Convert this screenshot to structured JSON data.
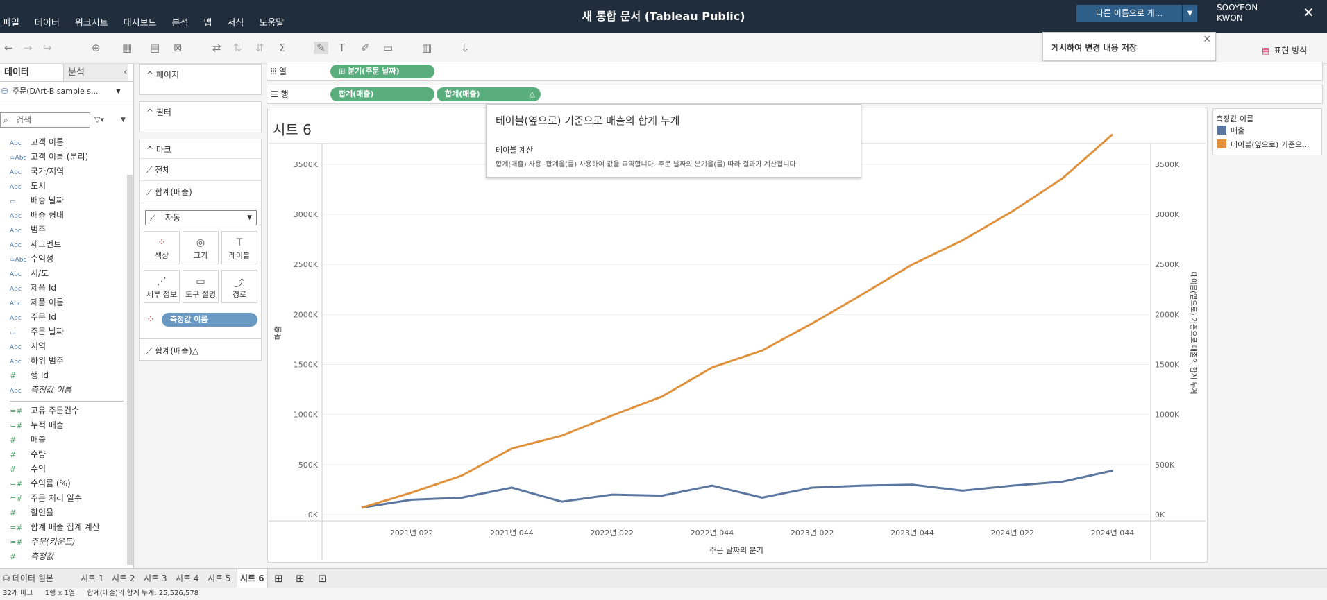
{
  "app": {
    "title": "새 통합 문서 (Tableau Public)",
    "menu": [
      "파일",
      "데이터",
      "워크시트",
      "대시보드",
      "분석",
      "맵",
      "서식",
      "도움말"
    ],
    "save_button": "다른 이름으로 게...",
    "user_name": [
      "SOOYEON",
      "KWON"
    ],
    "save_tooltip": "게시하여 변경 내용 저장",
    "present_label": "표현 방식"
  },
  "data_pane": {
    "tabs": [
      "데이터",
      "분석"
    ],
    "datasource": "주문(DArt-B sample s...",
    "search_placeholder": "검색",
    "dimensions": [
      {
        "icon": "Abc",
        "name": "고객 이름"
      },
      {
        "icon": "=Abc",
        "name": "고객 이름 (분리)"
      },
      {
        "icon": "Abc",
        "name": "국가/지역"
      },
      {
        "icon": "Abc",
        "name": "도시"
      },
      {
        "icon": "date",
        "name": "배송 날짜"
      },
      {
        "icon": "Abc",
        "name": "배송 형태"
      },
      {
        "icon": "Abc",
        "name": "범주"
      },
      {
        "icon": "Abc",
        "name": "세그먼트"
      },
      {
        "icon": "=Abc",
        "name": "수익성"
      },
      {
        "icon": "Abc",
        "name": "시/도"
      },
      {
        "icon": "Abc",
        "name": "제품 Id"
      },
      {
        "icon": "Abc",
        "name": "제품 이름"
      },
      {
        "icon": "Abc",
        "name": "주문 Id"
      },
      {
        "icon": "date",
        "name": "주문 날짜"
      },
      {
        "icon": "Abc",
        "name": "지역"
      },
      {
        "icon": "Abc",
        "name": "하위 범주"
      },
      {
        "icon": "#",
        "name": "행 Id"
      },
      {
        "icon": "Abc",
        "name": "측정값 이름",
        "italic": true
      }
    ],
    "measures": [
      {
        "icon": "=#",
        "name": "고유 주문건수"
      },
      {
        "icon": "=#",
        "name": "누적 매출"
      },
      {
        "icon": "#",
        "name": "매출"
      },
      {
        "icon": "#",
        "name": "수량"
      },
      {
        "icon": "#",
        "name": "수익"
      },
      {
        "icon": "=#",
        "name": "수익률 (%)"
      },
      {
        "icon": "=#",
        "name": "주문 처리 일수"
      },
      {
        "icon": "#",
        "name": "할인율"
      },
      {
        "icon": "=#",
        "name": "합계 매출 집계 계산"
      },
      {
        "icon": "=#",
        "name": "주문(카운트)",
        "italic": true
      },
      {
        "icon": "#",
        "name": "측정값",
        "italic": true
      }
    ]
  },
  "cards": {
    "pages": "페이지",
    "filters": "필터",
    "marks": "마크",
    "mark_rows": [
      "전체",
      "합계(매출)"
    ],
    "mark_type": "자동",
    "mark_buttons": [
      "색상",
      "크기",
      "레이블",
      "세부 정보",
      "도구 설명",
      "경로"
    ],
    "color_pill": "측정값 이름",
    "second_mark": "합계(매출)△"
  },
  "shelves": {
    "columns_label": "열",
    "rows_label": "행",
    "columns_pills": [
      "분기(주문 날짜)"
    ],
    "rows_pills": [
      "합계(매출)",
      "합계(매출)"
    ]
  },
  "sheet": {
    "title": "시트 6"
  },
  "calc_tooltip": {
    "title": "테이블(옆으로) 기준으로 매출의 합계 누계",
    "subtitle": "테이블 계산",
    "body": "합계(매출) 사용. 합계을(를) 사용하여 값을 요약합니다.  주문 날짜의 분기을(를) 따라 결과가 계산됩니다."
  },
  "legend": {
    "title": "측정값 이름",
    "items": [
      {
        "label": "매출",
        "color": "#5b77a0"
      },
      {
        "label": "테이블(옆으로) 기준으...",
        "color": "#e0913c"
      }
    ]
  },
  "chart_data": {
    "type": "line",
    "x": [
      "2021년 Q1",
      "2021년 Q2",
      "2021년 Q3",
      "2021년 Q4",
      "2022년 Q1",
      "2022년 Q2",
      "2022년 Q3",
      "2022년 Q4",
      "2023년 Q1",
      "2023년 Q2",
      "2023년 Q3",
      "2023년 Q4",
      "2024년 Q1",
      "2024년 Q2",
      "2024년 Q3",
      "2024年 Q4"
    ],
    "x_tick_labels": [
      "2021년 022",
      "2021년 044",
      "2022년 022",
      "2022년 044",
      "2023년 022",
      "2023년 044",
      "2024년 022",
      "2024년 044"
    ],
    "xlabel": "주문 날짜의 분기",
    "ylabel_left": "매출",
    "ylabel_right": "테이블(옆으로) 기준으로 매출의 합계 누계",
    "y_ticks": [
      "0K",
      "500K",
      "1000K",
      "1500K",
      "2000K",
      "2500K",
      "3000K",
      "3500K"
    ],
    "ylim": [
      0,
      3700000
    ],
    "series": [
      {
        "name": "매출",
        "color": "#5b77a0",
        "values": [
          70000,
          150000,
          170000,
          270000,
          130000,
          200000,
          190000,
          290000,
          170000,
          270000,
          290000,
          300000,
          240000,
          290000,
          330000,
          440000
        ]
      },
      {
        "name": "테이블(옆으로) 기준으...",
        "color": "#e0913c",
        "values": [
          70000,
          220000,
          390000,
          660000,
          790000,
          990000,
          1180000,
          1470000,
          1640000,
          1910000,
          2200000,
          2500000,
          2740000,
          3030000,
          3360000,
          3800000
        ]
      }
    ]
  },
  "bottom": {
    "datasource_tab": "데이터 원본",
    "sheets": [
      "시트 1",
      "시트 2",
      "시트 3",
      "시트 4",
      "시트 5",
      "시트 6"
    ],
    "status_marks": "32개 마크",
    "status_grid": "1행 x 1열",
    "status_sum": "합계(매출)의 합계 누계: 25,526,578"
  }
}
